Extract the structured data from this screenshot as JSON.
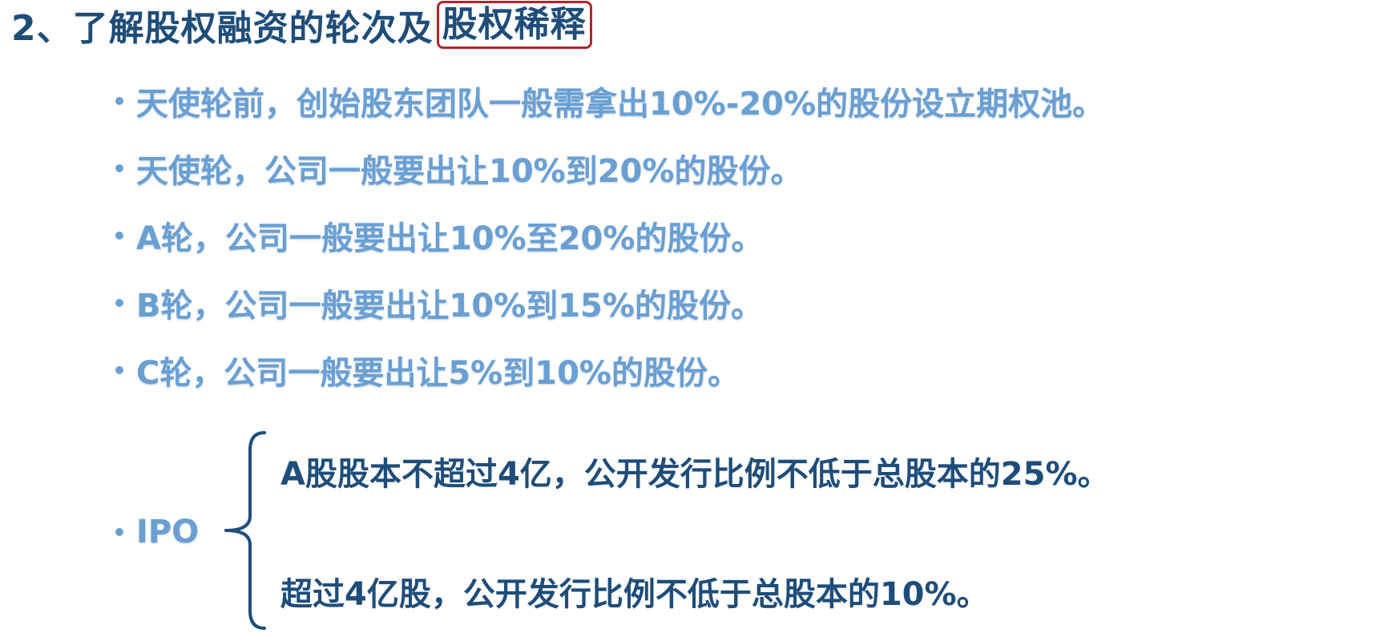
{
  "title": {
    "prefix": "2、了解股权融资的轮次及",
    "highlighted": "股权稀释"
  },
  "bullets": [
    "天使轮前，创始股东团队一般需拿出10%-20%的股份设立期权池。",
    "天使轮，公司一般要出让10%到20%的股份。",
    "A轮，公司一般要出让10%至20%的股份。",
    "B轮，公司一般要出让10%到15%的股份。",
    "C轮，公司一般要出让5%到10%的股份。"
  ],
  "ipo": {
    "label": "IPO",
    "items": [
      "A股股本不超过4亿，公开发行比例不低于总股本的25%。",
      "超过4亿股，公开发行比例不低于总股本的10%。"
    ]
  },
  "colors": {
    "title": "#1f4d79",
    "bullet": "#6a9fd2",
    "highlight_border": "#b0262c"
  }
}
